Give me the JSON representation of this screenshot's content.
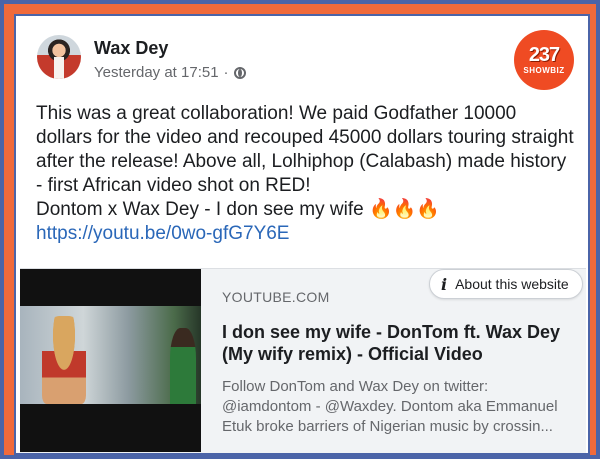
{
  "post": {
    "author": "Wax Dey",
    "timestamp": "Yesterday at 17:51",
    "separator": "·",
    "text_lines": [
      "This was a great collaboration! We paid Godfather 10000 dollars for the video and recouped 45000 dollars touring straight after the release! Above all, Lolhiphop (Calabash) made history - first African video shot on RED!",
      "Dontom x Wax Dey - I don see my wife 🔥🔥🔥"
    ],
    "link": "https://youtu.be/0wo-gfG7Y6E"
  },
  "logo": {
    "big": "237",
    "small": "SHOWBIZ"
  },
  "preview": {
    "source": "YOUTUBE.COM",
    "about_label": "About this website",
    "title": "I don see my wife - DonTom ft. Wax Dey (My wify remix) - Official Video",
    "description_lines": [
      "Follow DonTom and Wax Dey on twitter:",
      "@iamdontom - @Waxdey. Dontom aka Emmanuel",
      "Etuk broke barriers of Nigerian music by crossin..."
    ]
  },
  "colors": {
    "frame_blue": "#4b64a8",
    "frame_orange": "#f06a3b",
    "link": "#2a67b8",
    "logo": "#ef4b23"
  },
  "icons": [
    "globe-icon",
    "info-icon"
  ]
}
